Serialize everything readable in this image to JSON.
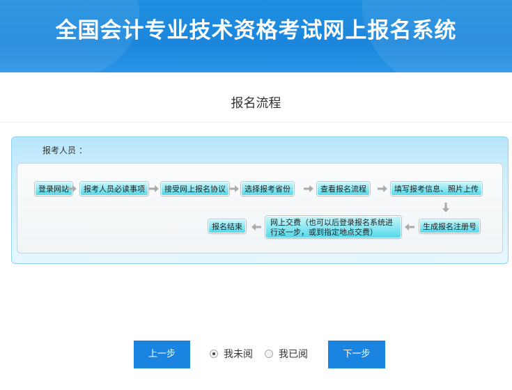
{
  "header": {
    "title": "全国会计专业技术资格考试网上报名系统"
  },
  "page": {
    "title": "报名流程"
  },
  "flow": {
    "role_label": "报考人员 ：",
    "steps": [
      "登录网站",
      "报考人员必读事项",
      "接受网上报名协议",
      "选择报考省份",
      "查看报名流程",
      "填写报考信息、照片上传",
      "生成报名注册号",
      "网上交费（也可以后登录报名系统进行这一步，或到指定地点交费）",
      "报名结束"
    ]
  },
  "footer": {
    "prev_label": "上一步",
    "next_label": "下一步",
    "radio_unread": "我未阅",
    "radio_read": "我已阅",
    "selected": "我未阅"
  },
  "colors": {
    "primary": "#1a84e0",
    "step_fill": "#55d9ea"
  }
}
